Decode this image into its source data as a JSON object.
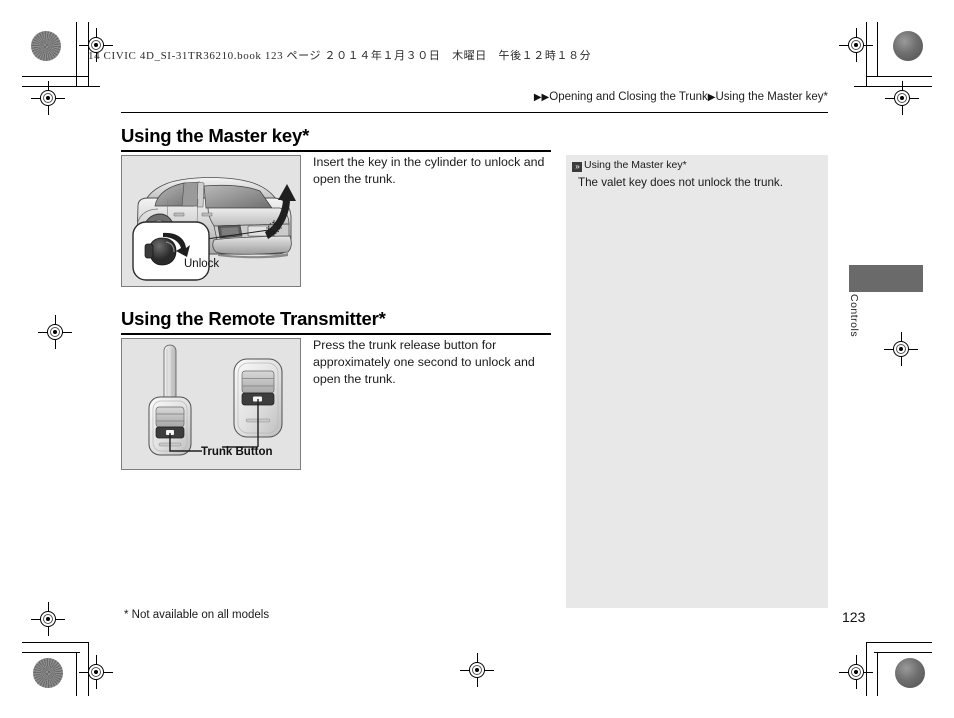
{
  "document": {
    "running_head": "14 CIVIC 4D_SI-31TR36210.book   123 ページ   ２０１４年１月３０日　木曜日　午後１２時１８分",
    "page_number": "123",
    "footnote": "* Not available on all models",
    "thumb_tab_label": "Controls"
  },
  "breadcrumb": {
    "marker": "▶▶",
    "parent": "Opening and Closing the Trunk",
    "separator": "▶",
    "current": "Using the Master key*"
  },
  "sections": [
    {
      "heading": "Using the Master key*",
      "body": "Insert the key in the cylinder to unlock and open the trunk.",
      "figure": {
        "name": "car-rear-trunk-illustration",
        "callout_label": "Unlock"
      }
    },
    {
      "heading": "Using the Remote Transmitter*",
      "body": "Press the trunk release button for approximately one second to unlock and open the trunk.",
      "figure": {
        "name": "remote-transmitter-illustration",
        "callout_label": "Trunk Button"
      }
    }
  ],
  "side_note": {
    "badge": "»",
    "title": "Using the Master key*",
    "body": "The valet key does not unlock the trunk."
  },
  "colors": {
    "figure_background": "#e3e3e3",
    "side_panel_background": "#e8e8e8",
    "thumb_tab": "#6a6a6a",
    "text": "#1a1a1a"
  }
}
